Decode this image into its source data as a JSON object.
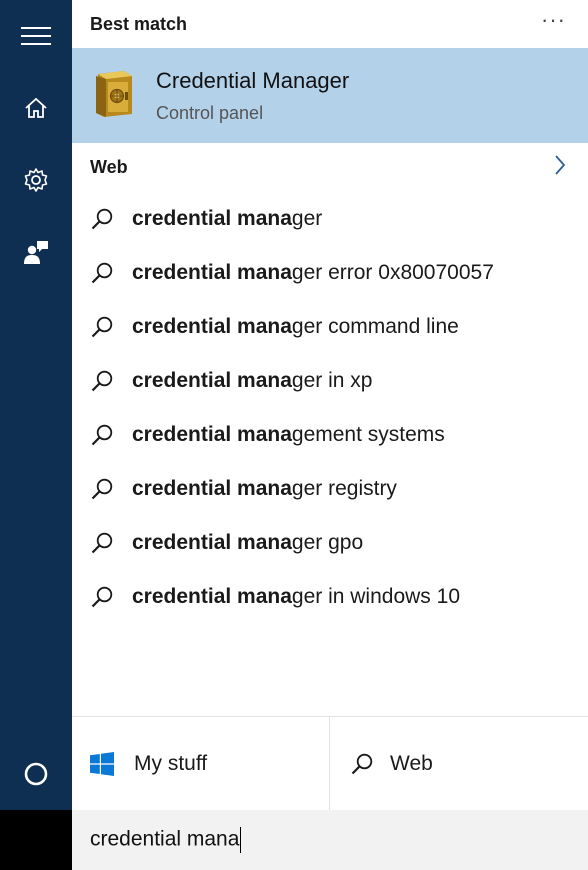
{
  "rail": {
    "menu_icon": "hamburger-icon",
    "home_icon": "home-icon",
    "settings_icon": "gear-icon",
    "feedback_icon": "feedback-icon",
    "cortana_icon": "cortana-circle-icon"
  },
  "best_match": {
    "header": "Best match",
    "more": "···",
    "title": "Credential Manager",
    "subtitle": "Control panel",
    "icon": "credential-manager-vault-icon"
  },
  "web": {
    "header": "Web",
    "chevron": "chevron-right-icon",
    "results": [
      {
        "bold": "credential mana",
        "rest": "ger"
      },
      {
        "bold": "credential mana",
        "rest": "ger error 0x80070057"
      },
      {
        "bold": "credential mana",
        "rest": "ger command line"
      },
      {
        "bold": "credential mana",
        "rest": "ger in xp"
      },
      {
        "bold": "credential mana",
        "rest": "gement systems"
      },
      {
        "bold": "credential mana",
        "rest": "ger registry"
      },
      {
        "bold": "credential mana",
        "rest": "ger gpo"
      },
      {
        "bold": "credential mana",
        "rest": "ger in windows 10"
      }
    ]
  },
  "scope": {
    "my_stuff": "My stuff",
    "my_stuff_icon": "windows-logo-icon",
    "web": "Web",
    "web_icon": "search-icon"
  },
  "search": {
    "query": "credential mana"
  },
  "colors": {
    "rail": "#0f2f52",
    "highlight": "#b4d1ea",
    "windows_blue": "#0a78d7"
  }
}
